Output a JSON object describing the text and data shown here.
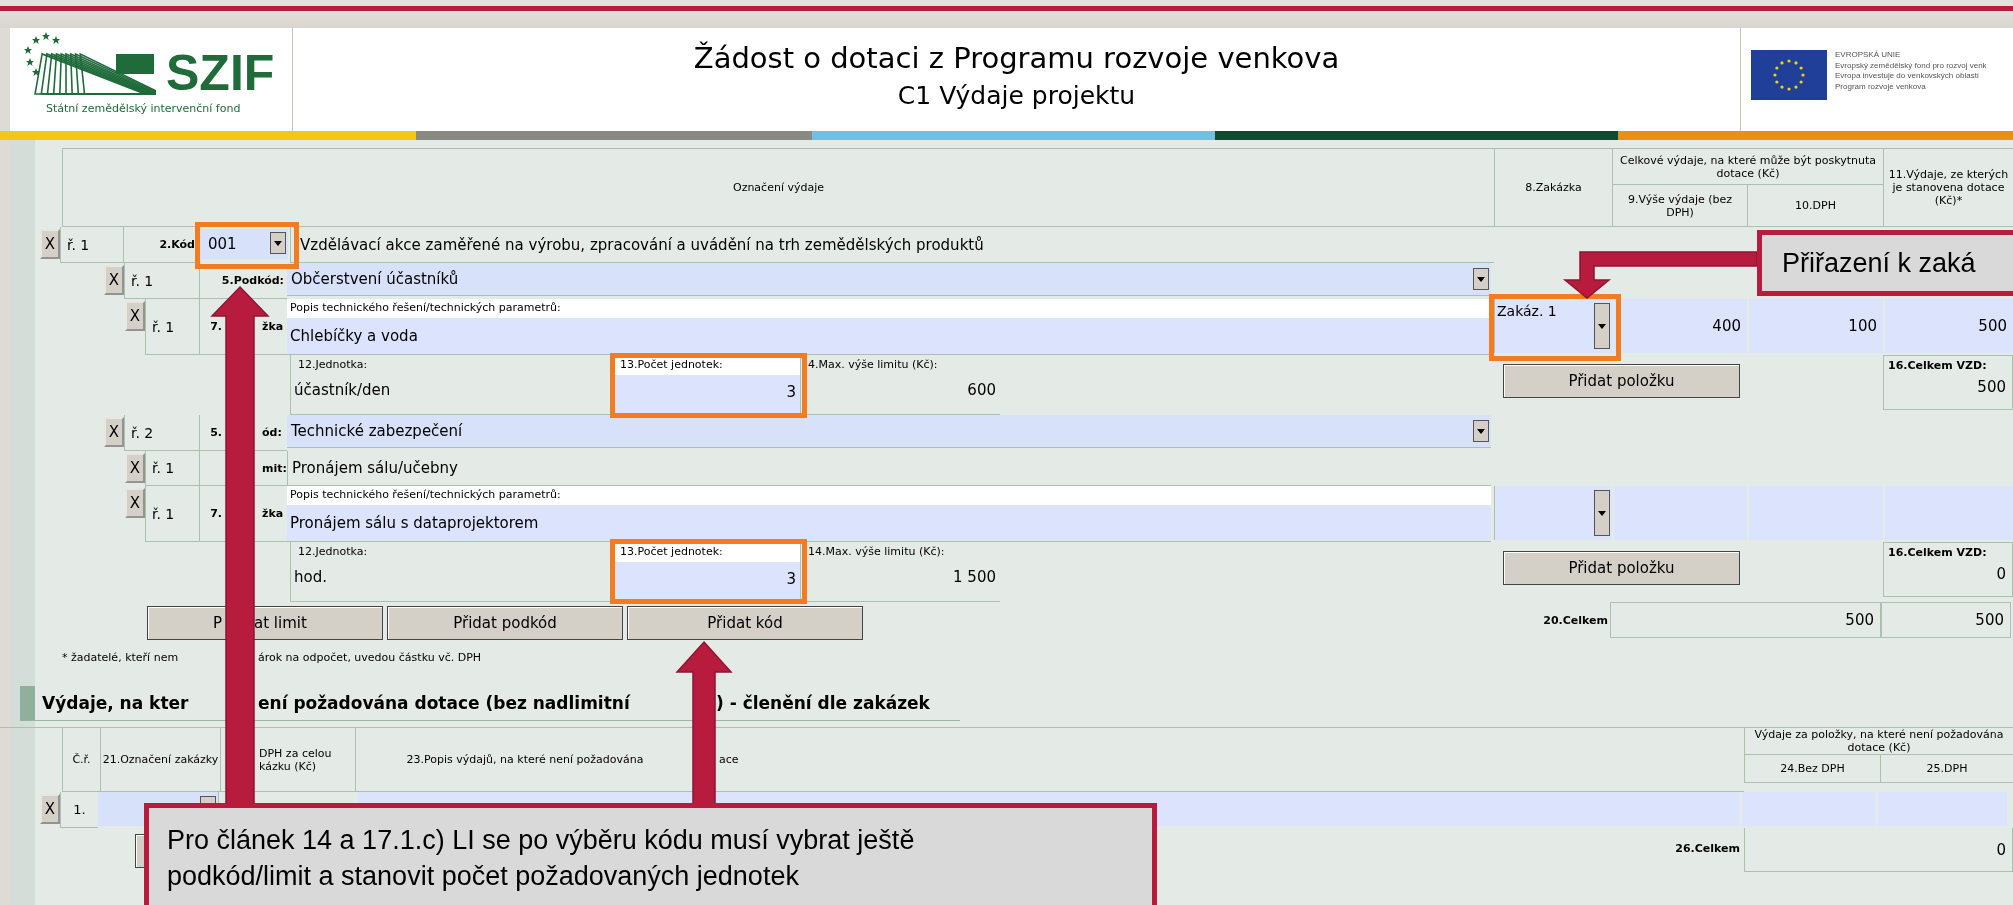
{
  "header": {
    "logo": {
      "abbr": "SZIF",
      "name": "Státní zemědělský intervenční fond"
    },
    "title": "Žádost o dotaci z Programu rozvoje venkova",
    "subtitle": "C1 Výdaje projektu",
    "eu_lines": [
      "EVROPSKÁ UNIE",
      "Evropský zemědělský fond pro rozvoj venk",
      "Evropa investuje do venkovských oblastí",
      "Program rozvoje venkova"
    ]
  },
  "expenses": {
    "columns": {
      "designation": "Označení výdaje",
      "contract": "8.Zakázka",
      "group": "Celkové výdaje, na které může být poskytnuta dotace (Kč)",
      "amount": "9.Výše výdaje (bez DPH)",
      "vat": "10.DPH",
      "subsidy": "11.Výdaje, ze kterých je stanovena dotace (Kč)*"
    },
    "code_row": {
      "remove": "X",
      "row_no": "ř. 1",
      "label": "2.Kód",
      "code": "001",
      "description": "Vzdělávací akce zaměřené na výrobu, zpracování a uvádění na trh zemědělských produktů"
    },
    "subcodes": [
      {
        "remove": "X",
        "row_no": "ř. 1",
        "label": "5.Podkód:",
        "value": "Občerstvení účastníků",
        "items": [
          {
            "remove": "X",
            "row_no": "ř. 1",
            "label_before": "7.",
            "label_after": "žka",
            "caption": "Popis technického řešení/technických parametrů:",
            "value": "Chlebíčky a voda",
            "contract": "Zakáz. 1",
            "amount": "400",
            "vat": "100",
            "subsidy": "500",
            "unit_label": "12.Jednotka:",
            "unit": "účastník/den",
            "count_label": "13.Počet jednotek:",
            "count": "3",
            "max_label": "4.Max. výše limitu (Kč):",
            "max": "600"
          }
        ],
        "add_item": "Přidat položku",
        "total_label": "16.Celkem VZD:",
        "total": "500"
      },
      {
        "remove": "X",
        "row_no": "ř. 2",
        "label_before": "5.",
        "label_after": "ód:",
        "value": "Technické zabezpečení",
        "limit": {
          "remove": "X",
          "row_no": "ř. 1",
          "label_after": "mit:",
          "value": "Pronájem sálu/učebny"
        },
        "items": [
          {
            "remove": "X",
            "row_no": "ř. 1",
            "label_before": "7.",
            "label_after": "žka",
            "caption": "Popis technického řešení/technických parametrů:",
            "value": "Pronájem sálu s dataprojektorem",
            "unit_label": "12.Jednotka:",
            "unit": "hod.",
            "count_label": "13.Počet jednotek:",
            "count": "3",
            "max_label": "14.Max. výše limitu (Kč):",
            "max": "1 500"
          }
        ],
        "add_item": "Přidat položku",
        "total_label": "16.Celkem VZD:",
        "total": "0"
      }
    ],
    "buttons": [
      {
        "before": "P",
        "after": "at limit"
      },
      {
        "label": "Přidat podkód"
      },
      {
        "label": "Přidat kód"
      }
    ],
    "total_label": "20.Celkem",
    "total_amount": "500",
    "total_subsidy": "500",
    "footnote": {
      "before": "* žadatelé, kteří nem",
      "after": "árok na odpočet, uvedou částku vč. DPH"
    }
  },
  "contracts": {
    "heading": [
      "Výdaje, na kter",
      "ení požadována dotace (bez nadlimitní",
      ") - členění dle zakázek"
    ],
    "columns": {
      "row_no": "Č.ř.",
      "designation": "21.Označení zakázky",
      "column_3": "DPH za celou kázku (Kč)",
      "description_before": "23.Popis výdajů, na které není požadována",
      "description_after": "ace",
      "group": "Výdaje za položky, na které není požadována dotace (Kč)",
      "net": "24.Bez DPH",
      "vat": "25.DPH"
    },
    "rows": [
      {
        "remove": "X",
        "row_no": "1."
      }
    ],
    "total_label": "26.Celkem",
    "total": "0"
  },
  "annotations": [
    {
      "kind": "callout",
      "text": "Přiřazení k zaká"
    },
    {
      "kind": "callout",
      "text": "Pro článek 14 a 17.1.c) LI se po výběru kódu musí vybrat ještě podkód/limit a stanovit počet požadovaných jednotek"
    }
  ]
}
